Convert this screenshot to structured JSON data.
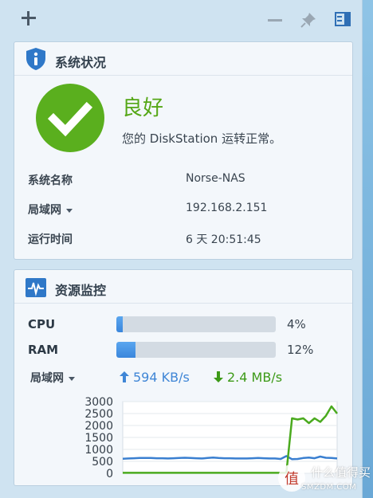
{
  "topbar": {
    "icons": [
      "add-icon",
      "minimize-icon",
      "pin-icon",
      "panel-toggle-icon"
    ]
  },
  "system_status": {
    "title": "系统状况",
    "status": "良好",
    "message": "您的 DiskStation 运转正常。",
    "rows": [
      {
        "label": "系统名称",
        "value": "Norse-NAS"
      },
      {
        "label": "局域网",
        "value": "192.168.2.151",
        "dropdown": true
      },
      {
        "label": "运行时间",
        "value": "6 天 20:51:45"
      }
    ],
    "status_color": "#5aaf1e"
  },
  "resource_monitor": {
    "title": "资源监控",
    "cpu": {
      "label": "CPU",
      "value": "4%",
      "percent": 4
    },
    "ram": {
      "label": "RAM",
      "value": "12%",
      "percent": 12
    },
    "network": {
      "label": "局域网",
      "upload": "594 KB/s",
      "download": "2.4 MB/s"
    }
  },
  "chart_data": {
    "type": "line",
    "y_ticks": [
      "3000",
      "2500",
      "2000",
      "1500",
      "1000",
      "500",
      "0"
    ],
    "ylim": [
      0,
      3000
    ],
    "grid": true,
    "series": [
      {
        "color": "#3a7fd0",
        "values": [
          610,
          620,
          630,
          640,
          640,
          640,
          630,
          630,
          620,
          630,
          640,
          650,
          640,
          630,
          620,
          640,
          660,
          640,
          630,
          630,
          620,
          620,
          620,
          630,
          640,
          630,
          620,
          620,
          600,
          720,
          590,
          600,
          640,
          660,
          630,
          700,
          650,
          640,
          620
        ]
      },
      {
        "color": "#4aaa1e",
        "values": [
          20,
          20,
          20,
          20,
          20,
          20,
          20,
          20,
          20,
          20,
          20,
          20,
          20,
          20,
          20,
          20,
          20,
          20,
          20,
          20,
          20,
          20,
          20,
          20,
          20,
          20,
          20,
          20,
          20,
          20,
          2300,
          2250,
          2300,
          2100,
          2300,
          2150,
          2400,
          2800,
          2500
        ]
      }
    ]
  },
  "watermark": {
    "line1": "什么值得买",
    "line2": "SMZDM.COM"
  }
}
